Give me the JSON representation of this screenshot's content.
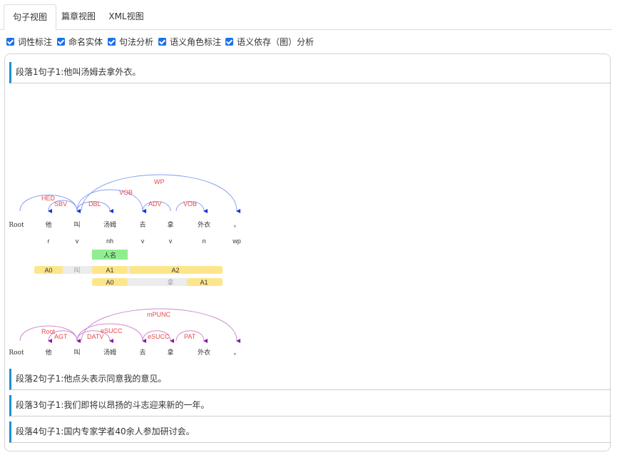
{
  "tabs": [
    {
      "label": "句子视图"
    },
    {
      "label": "篇章视图"
    },
    {
      "label": "XML视图"
    }
  ],
  "options": [
    {
      "label": "词性标注",
      "checked": true
    },
    {
      "label": "命名实体",
      "checked": true
    },
    {
      "label": "句法分析",
      "checked": true
    },
    {
      "label": "语义角色标注",
      "checked": true
    },
    {
      "label": "语义依存（图）分析",
      "checked": true
    }
  ],
  "sentences": [
    {
      "label": "段落1句子1:他叫汤姆去拿外衣。"
    },
    {
      "label": "段落2句子1:他点头表示同意我的意见。"
    },
    {
      "label": "段落3句子1:我们即将以昂扬的斗志迎来新的一年。"
    },
    {
      "label": "段落4句子1:国内专家学者40余人参加研讨会。"
    }
  ],
  "parse": {
    "words": [
      "Root",
      "他",
      "叫",
      "汤姆",
      "去",
      "拿",
      "外衣",
      "。"
    ],
    "pos": [
      "",
      "r",
      "v",
      "nh",
      "v",
      "v",
      "n",
      "wp"
    ],
    "ner": "人名",
    "dep_labels": [
      "HED",
      "SBV",
      "DBL",
      "VOB",
      "ADV",
      "VOB",
      "WP"
    ],
    "srl_row1": {
      "a0": "A0",
      "pred": "叫",
      "a1": "A1",
      "a2": "A2"
    },
    "srl_row2": {
      "a0": "A0",
      "pred": "拿",
      "a1": "A1"
    },
    "sdp_labels": [
      "Root",
      "AGT",
      "DATV",
      "eSUCC",
      "eSUCC",
      "PAT",
      "mPUNC"
    ],
    "colors": {
      "dep_arc": "#8aa0f0",
      "dep_arrow": "#1a32d8",
      "sdp_arc": "#d08ad0",
      "sdp_arrow": "#8a1aa8",
      "label": "#e8484b",
      "ner": "#90ee90",
      "srl": "#fde68a"
    }
  }
}
